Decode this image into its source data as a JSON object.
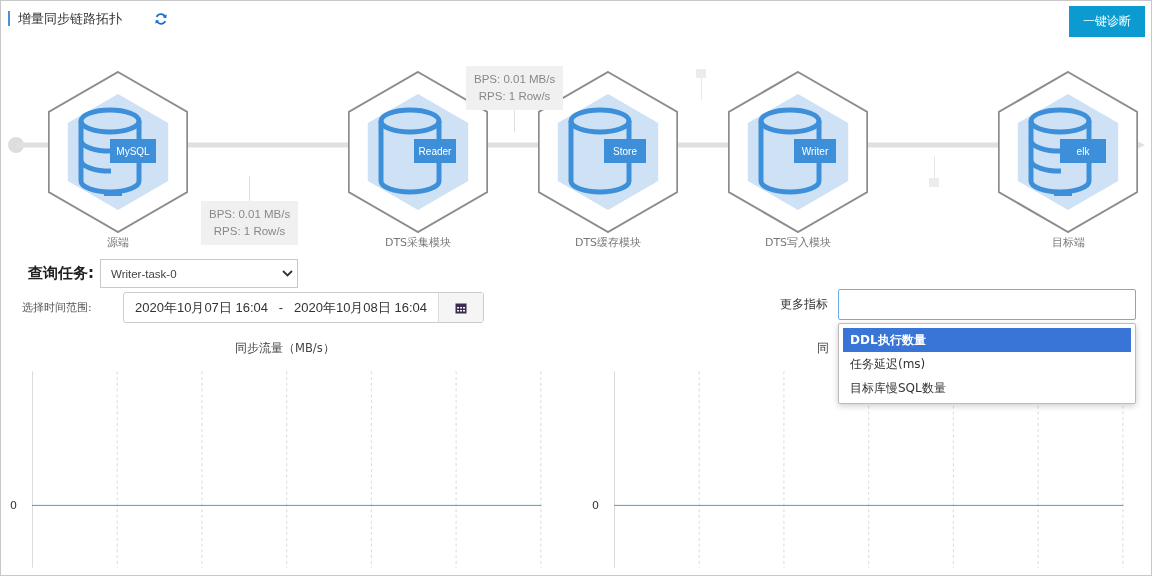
{
  "header": {
    "title": "增量同步链路拓扑",
    "diagnose_button": "一键诊断"
  },
  "topology": {
    "nodes": [
      {
        "label": "源端",
        "badge": "MySQL",
        "kind": "database"
      },
      {
        "label": "DTS采集模块",
        "badge": "Reader",
        "kind": "module"
      },
      {
        "label": "DTS缓存模块",
        "badge": "Store",
        "kind": "module"
      },
      {
        "label": "DTS写入模块",
        "badge": "Writer",
        "kind": "module"
      },
      {
        "label": "目标端",
        "badge": "elk",
        "kind": "database"
      }
    ],
    "links": [
      {
        "kind": "below",
        "bps": "BPS: 0.01 MB/s",
        "rps": "RPS: 1 Row/s"
      },
      {
        "kind": "above",
        "bps": "BPS: 0.01 MB/s",
        "rps": "RPS: 1 Row/s"
      },
      {
        "kind": "collapsed-above"
      },
      {
        "kind": "collapsed-below"
      }
    ]
  },
  "query": {
    "label": "查询任务:",
    "task": "Writer-task-0"
  },
  "time_range": {
    "label": "选择时间范围:",
    "value": "2020年10月07日 16:04   -   2020年10月08日 16:04"
  },
  "more_metrics": {
    "label": "更多指标",
    "options": [
      {
        "label": "DDL执行数量",
        "selected": true
      },
      {
        "label": "任务延迟(ms)",
        "selected": false
      },
      {
        "label": "目标库慢SQL数量",
        "selected": false
      }
    ]
  },
  "charts": [
    {
      "title": "同步流量（MB/s）",
      "y_tick": "0"
    },
    {
      "title": "同",
      "y_tick": "0"
    }
  ]
}
